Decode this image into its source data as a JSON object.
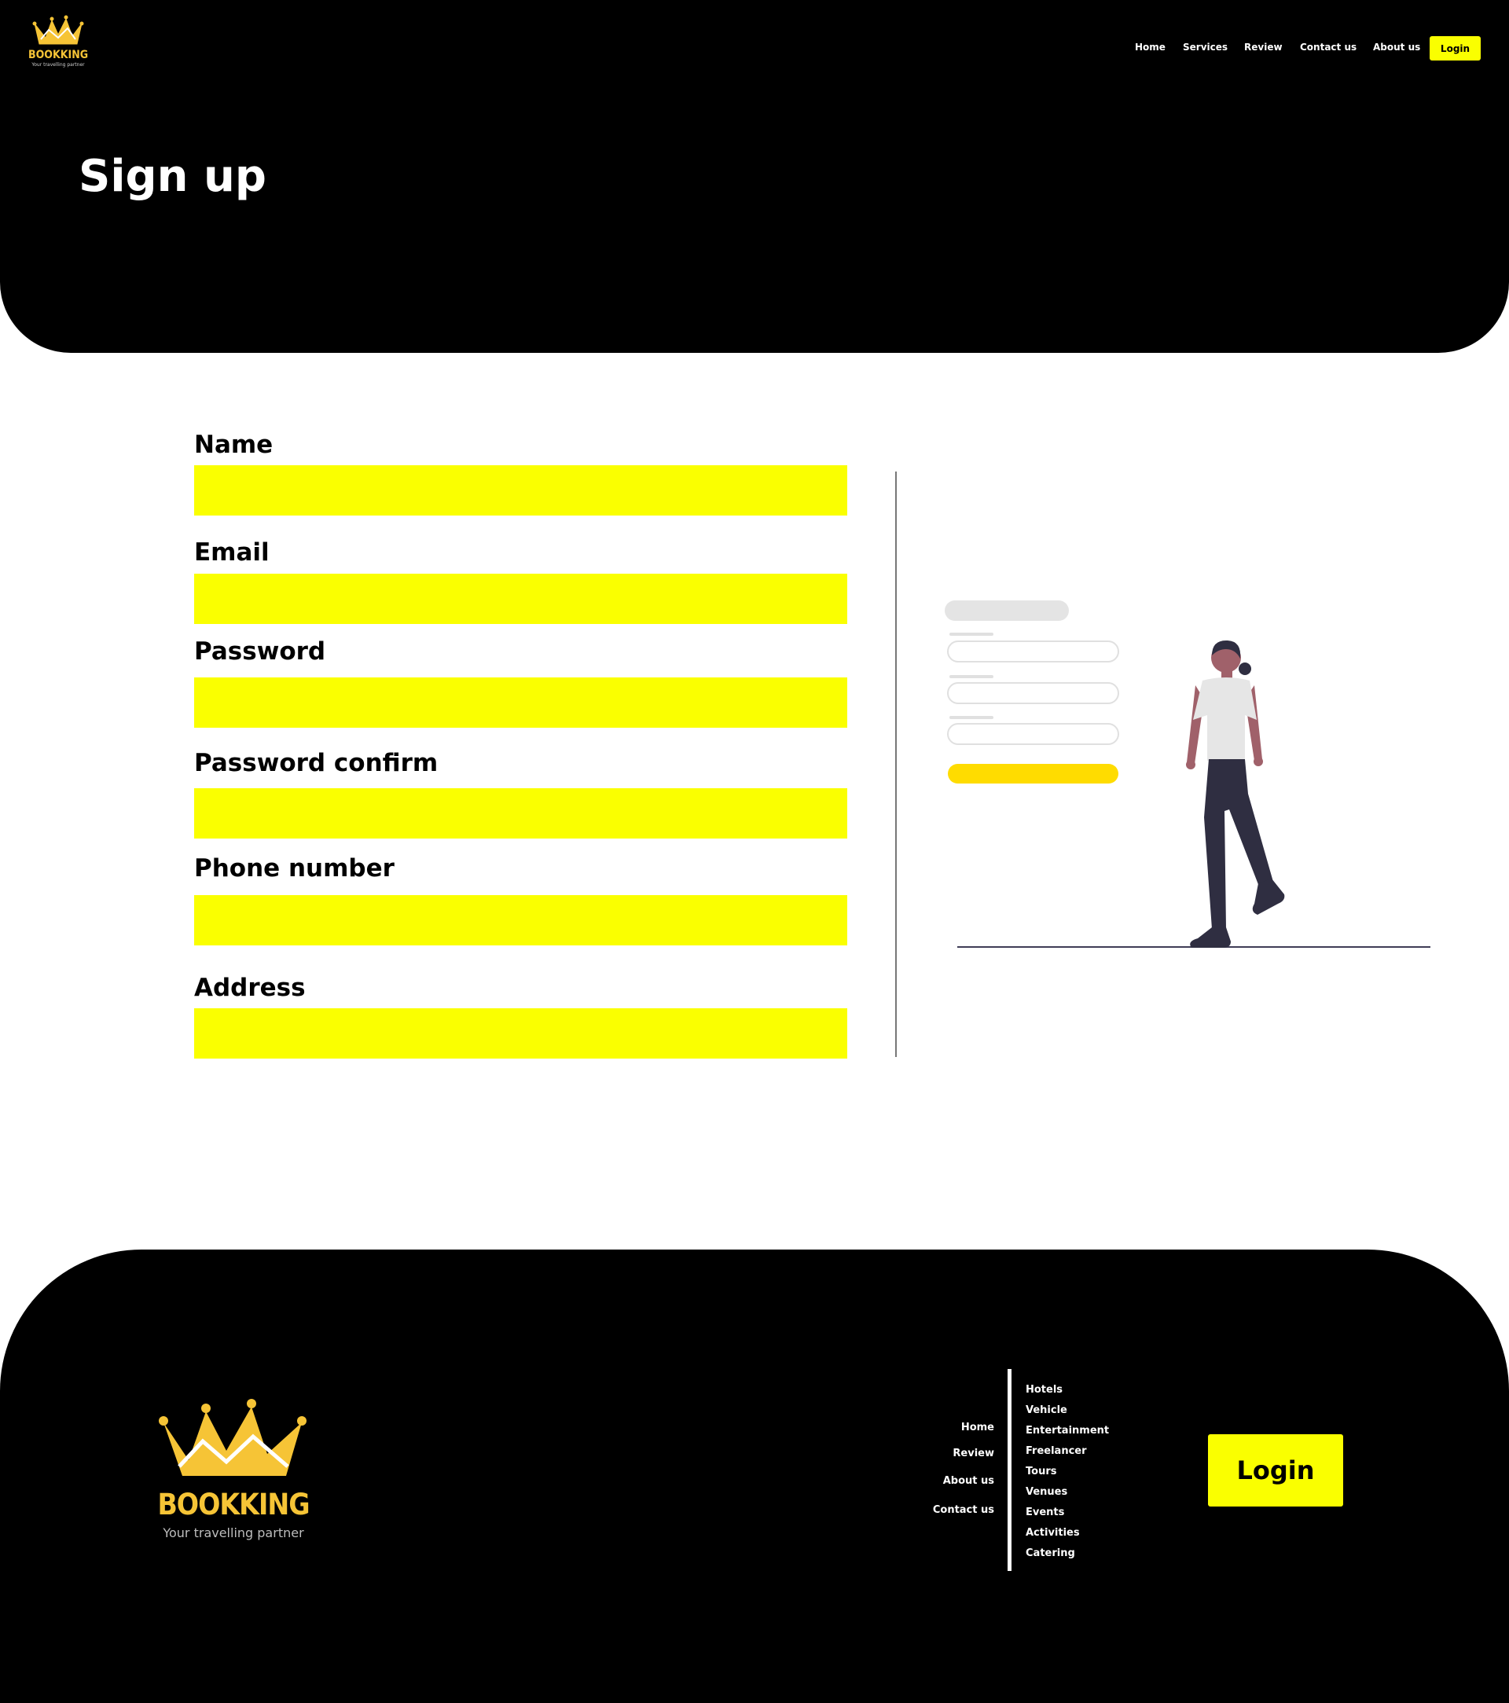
{
  "brand": {
    "name": "BOOKKING",
    "tagline": "Your travelling partner",
    "accent_color": "#faff00",
    "logo_color": "#f6c436"
  },
  "header": {
    "nav": [
      "Home",
      "Services",
      "Review",
      "Contact us",
      "About us"
    ],
    "login_label": "Login"
  },
  "page": {
    "title": "Sign up"
  },
  "form": {
    "fields": [
      {
        "label": "Name",
        "value": ""
      },
      {
        "label": "Email",
        "value": ""
      },
      {
        "label": "Password",
        "value": ""
      },
      {
        "label": "Password confirm",
        "value": ""
      },
      {
        "label": "Phone number",
        "value": ""
      },
      {
        "label": "Address",
        "value": ""
      }
    ]
  },
  "footer": {
    "nav_left": [
      "Home",
      "Review",
      "About us",
      "Contact us"
    ],
    "nav_right": [
      "Hotels",
      "Vehicle",
      "Entertainment",
      "Freelancer",
      "Tours",
      "Venues",
      "Events",
      "Activities",
      "Catering"
    ],
    "login_label": "Login"
  }
}
